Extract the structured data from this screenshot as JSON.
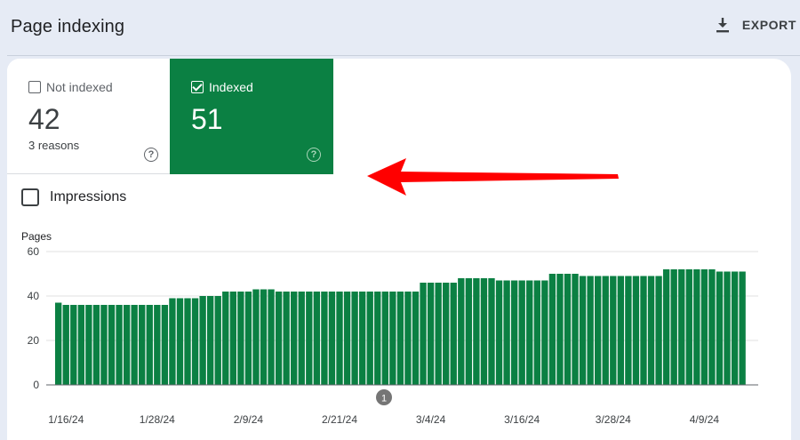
{
  "header": {
    "title": "Page indexing",
    "export_label": "EXPORT",
    "export_icon": "download-icon"
  },
  "tiles": {
    "not_indexed": {
      "label": "Not indexed",
      "value": "42",
      "sub": "3 reasons",
      "checked": false,
      "help_icon": "help-icon"
    },
    "indexed": {
      "label": "Indexed",
      "value": "51",
      "checked": true,
      "help_icon": "help-icon"
    }
  },
  "impressions": {
    "label": "Impressions",
    "checked": false
  },
  "annotation": {
    "arrow_color": "#ff0000"
  },
  "colors": {
    "bar": "#0b8043",
    "background": "#e6ebf5"
  },
  "chart_data": {
    "type": "bar",
    "ylabel": "Pages",
    "ylim": [
      0,
      60
    ],
    "yticks": [
      0,
      20,
      40,
      60
    ],
    "xtick_labels": [
      "1/16/24",
      "1/28/24",
      "2/9/24",
      "2/21/24",
      "3/4/24",
      "3/16/24",
      "3/28/24",
      "4/9/24"
    ],
    "annotation_marker": "1",
    "grid": true,
    "x": [
      "1/15/24",
      "1/16/24",
      "1/17/24",
      "1/18/24",
      "1/19/24",
      "1/20/24",
      "1/21/24",
      "1/22/24",
      "1/23/24",
      "1/24/24",
      "1/25/24",
      "1/26/24",
      "1/27/24",
      "1/28/24",
      "1/29/24",
      "1/30/24",
      "1/31/24",
      "2/1/24",
      "2/2/24",
      "2/3/24",
      "2/4/24",
      "2/5/24",
      "2/6/24",
      "2/7/24",
      "2/8/24",
      "2/9/24",
      "2/10/24",
      "2/11/24",
      "2/12/24",
      "2/13/24",
      "2/14/24",
      "2/15/24",
      "2/16/24",
      "2/17/24",
      "2/18/24",
      "2/19/24",
      "2/20/24",
      "2/21/24",
      "2/22/24",
      "2/23/24",
      "2/24/24",
      "2/25/24",
      "2/26/24",
      "2/27/24",
      "2/28/24",
      "2/29/24",
      "3/1/24",
      "3/2/24",
      "3/3/24",
      "3/4/24",
      "3/5/24",
      "3/6/24",
      "3/7/24",
      "3/8/24",
      "3/9/24",
      "3/10/24",
      "3/11/24",
      "3/12/24",
      "3/13/24",
      "3/14/24",
      "3/15/24",
      "3/16/24",
      "3/17/24",
      "3/18/24",
      "3/19/24",
      "3/20/24",
      "3/21/24",
      "3/22/24",
      "3/23/24",
      "3/24/24",
      "3/25/24",
      "3/26/24",
      "3/27/24",
      "3/28/24",
      "3/29/24",
      "3/30/24",
      "3/31/24",
      "4/1/24",
      "4/2/24",
      "4/3/24",
      "4/4/24",
      "4/5/24",
      "4/6/24",
      "4/7/24",
      "4/8/24",
      "4/9/24",
      "4/10/24",
      "4/11/24",
      "4/12/24",
      "4/13/24",
      "4/14/24"
    ],
    "values": [
      37,
      36,
      36,
      36,
      36,
      36,
      36,
      36,
      36,
      36,
      36,
      36,
      36,
      36,
      36,
      39,
      39,
      39,
      39,
      40,
      40,
      40,
      42,
      42,
      42,
      42,
      43,
      43,
      43,
      42,
      42,
      42,
      42,
      42,
      42,
      42,
      42,
      42,
      42,
      42,
      42,
      42,
      42,
      42,
      42,
      42,
      42,
      42,
      46,
      46,
      46,
      46,
      46,
      48,
      48,
      48,
      48,
      48,
      47,
      47,
      47,
      47,
      47,
      47,
      47,
      50,
      50,
      50,
      50,
      49,
      49,
      49,
      49,
      49,
      49,
      49,
      49,
      49,
      49,
      49,
      52,
      52,
      52,
      52,
      52,
      52,
      52,
      51,
      51,
      51,
      51
    ]
  }
}
